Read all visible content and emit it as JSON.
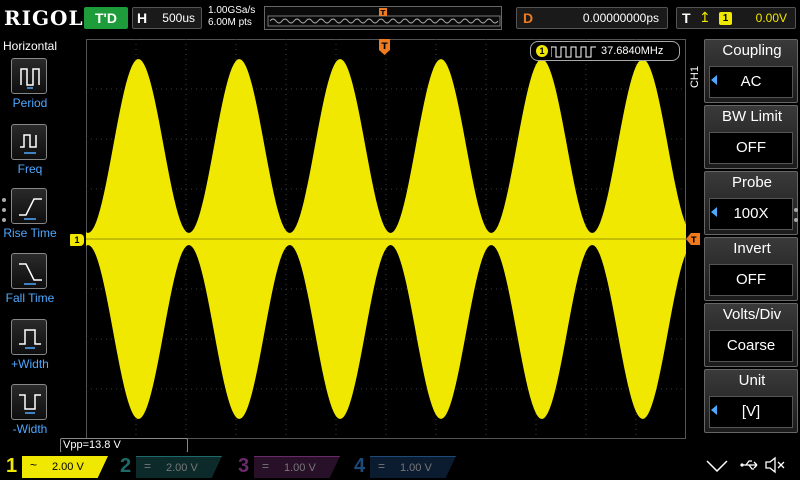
{
  "header": {
    "brand": "RIGOL",
    "run_state": "T'D",
    "horizontal_key": "H",
    "timebase": "500us",
    "sample_rate": "1.00GSa/s",
    "memory_depth": "6.00M pts",
    "delay_key": "D",
    "delay_value": "0.00000000ps",
    "trigger_key": "T",
    "trigger_edge": "rising-edge-icon",
    "trigger_source": "1",
    "trigger_level": "0.00V"
  },
  "left_menu": {
    "title": "Horizontal",
    "items": [
      {
        "label": "Period",
        "icon": "period-icon"
      },
      {
        "label": "Freq",
        "icon": "frequency-icon"
      },
      {
        "label": "Rise Time",
        "icon": "rise-time-icon"
      },
      {
        "label": "Fall Time",
        "icon": "fall-time-icon"
      },
      {
        "label": "+Width",
        "icon": "positive-width-icon"
      },
      {
        "label": "-Width",
        "icon": "negative-width-icon"
      }
    ]
  },
  "measurement": {
    "channel": "1",
    "frequency": "37.6840MHz",
    "vpp": "Vpp=13.8 V"
  },
  "markers": {
    "ch1": "1",
    "trigger": "T"
  },
  "right_menu": {
    "channel_tag": "CH1",
    "items": [
      {
        "title": "Coupling",
        "value": "AC",
        "has_arrow": true
      },
      {
        "title": "BW Limit",
        "value": "OFF",
        "has_arrow": false
      },
      {
        "title": "Probe",
        "value": "100X",
        "has_arrow": true
      },
      {
        "title": "Invert",
        "value": "OFF",
        "has_arrow": false
      },
      {
        "title": "Volts/Div",
        "value": "Coarse",
        "has_arrow": false
      },
      {
        "title": "Unit",
        "value": "[V]",
        "has_arrow": true
      }
    ]
  },
  "channels": [
    {
      "num": "1",
      "coupling": "~",
      "scale": "2.00 V",
      "active": true
    },
    {
      "num": "2",
      "coupling": "=",
      "scale": "2.00 V",
      "active": false
    },
    {
      "num": "3",
      "coupling": "=",
      "scale": "1.00 V",
      "active": false
    },
    {
      "num": "4",
      "coupling": "=",
      "scale": "1.00 V",
      "active": false
    }
  ],
  "colors": {
    "ch1": "#f0e800",
    "accent_blue": "#4fa8ff",
    "trigger_orange": "#f07b1e",
    "run_green": "#1e9b3a"
  },
  "waveform": {
    "type": "amplitude-modulated carrier",
    "envelope_cycles_visible": 6,
    "envelope_max_divisions": 3.6,
    "envelope_min_divisions": 0.12
  }
}
